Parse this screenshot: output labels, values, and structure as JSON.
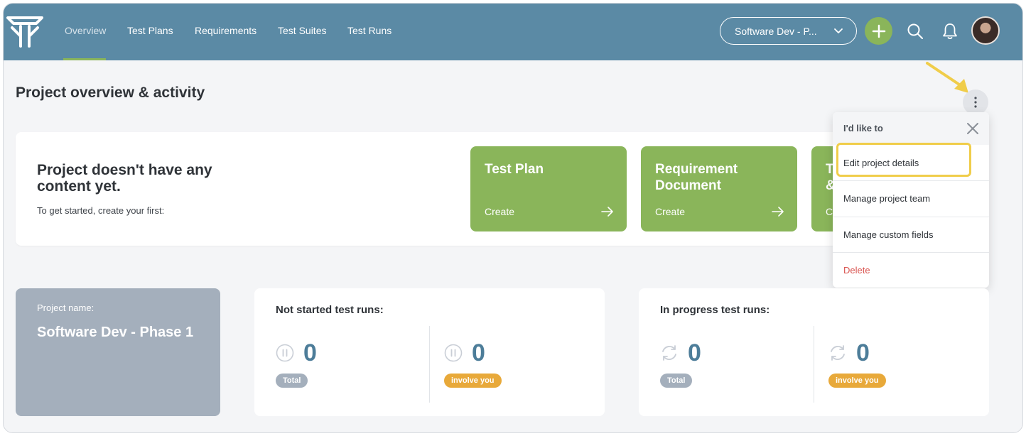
{
  "nav": {
    "items": [
      "Overview",
      "Test Plans",
      "Requirements",
      "Test Suites",
      "Test Runs"
    ],
    "active_index": 0
  },
  "header_controls": {
    "project_selector": "Software Dev - P...",
    "icons": [
      "add-icon",
      "search-icon",
      "bell-icon"
    ]
  },
  "page": {
    "title": "Project overview & activity"
  },
  "empty_state": {
    "title": "Project doesn't have any content yet.",
    "subtitle": "To get started, create your first:",
    "tiles": [
      {
        "title": "Test Plan",
        "action": "Create"
      },
      {
        "title": "Requirement Document",
        "action": "Create"
      },
      {
        "title": "T\n&",
        "action": "C"
      }
    ]
  },
  "menu": {
    "heading": "I'd like to",
    "items": [
      "Edit project details",
      "Manage project team",
      "Manage custom fields",
      "Delete"
    ]
  },
  "project_card": {
    "label": "Project name:",
    "name": "Software Dev - Phase 1"
  },
  "stats": [
    {
      "title": "Not started test runs:",
      "icon": "pause-circle-icon",
      "total_value": "0",
      "total_label": "Total",
      "you_value": "0",
      "you_label": "involve you"
    },
    {
      "title": "In progress test runs:",
      "icon": "refresh-icon",
      "total_value": "0",
      "total_label": "Total",
      "you_value": "0",
      "you_label": "involve you"
    }
  ],
  "colors": {
    "topbar": "#5b8aa5",
    "accent_green": "#8ab55a",
    "highlight_yellow": "#f0cd4a",
    "danger": "#d9534f",
    "badge_orange": "#e8a93a"
  }
}
